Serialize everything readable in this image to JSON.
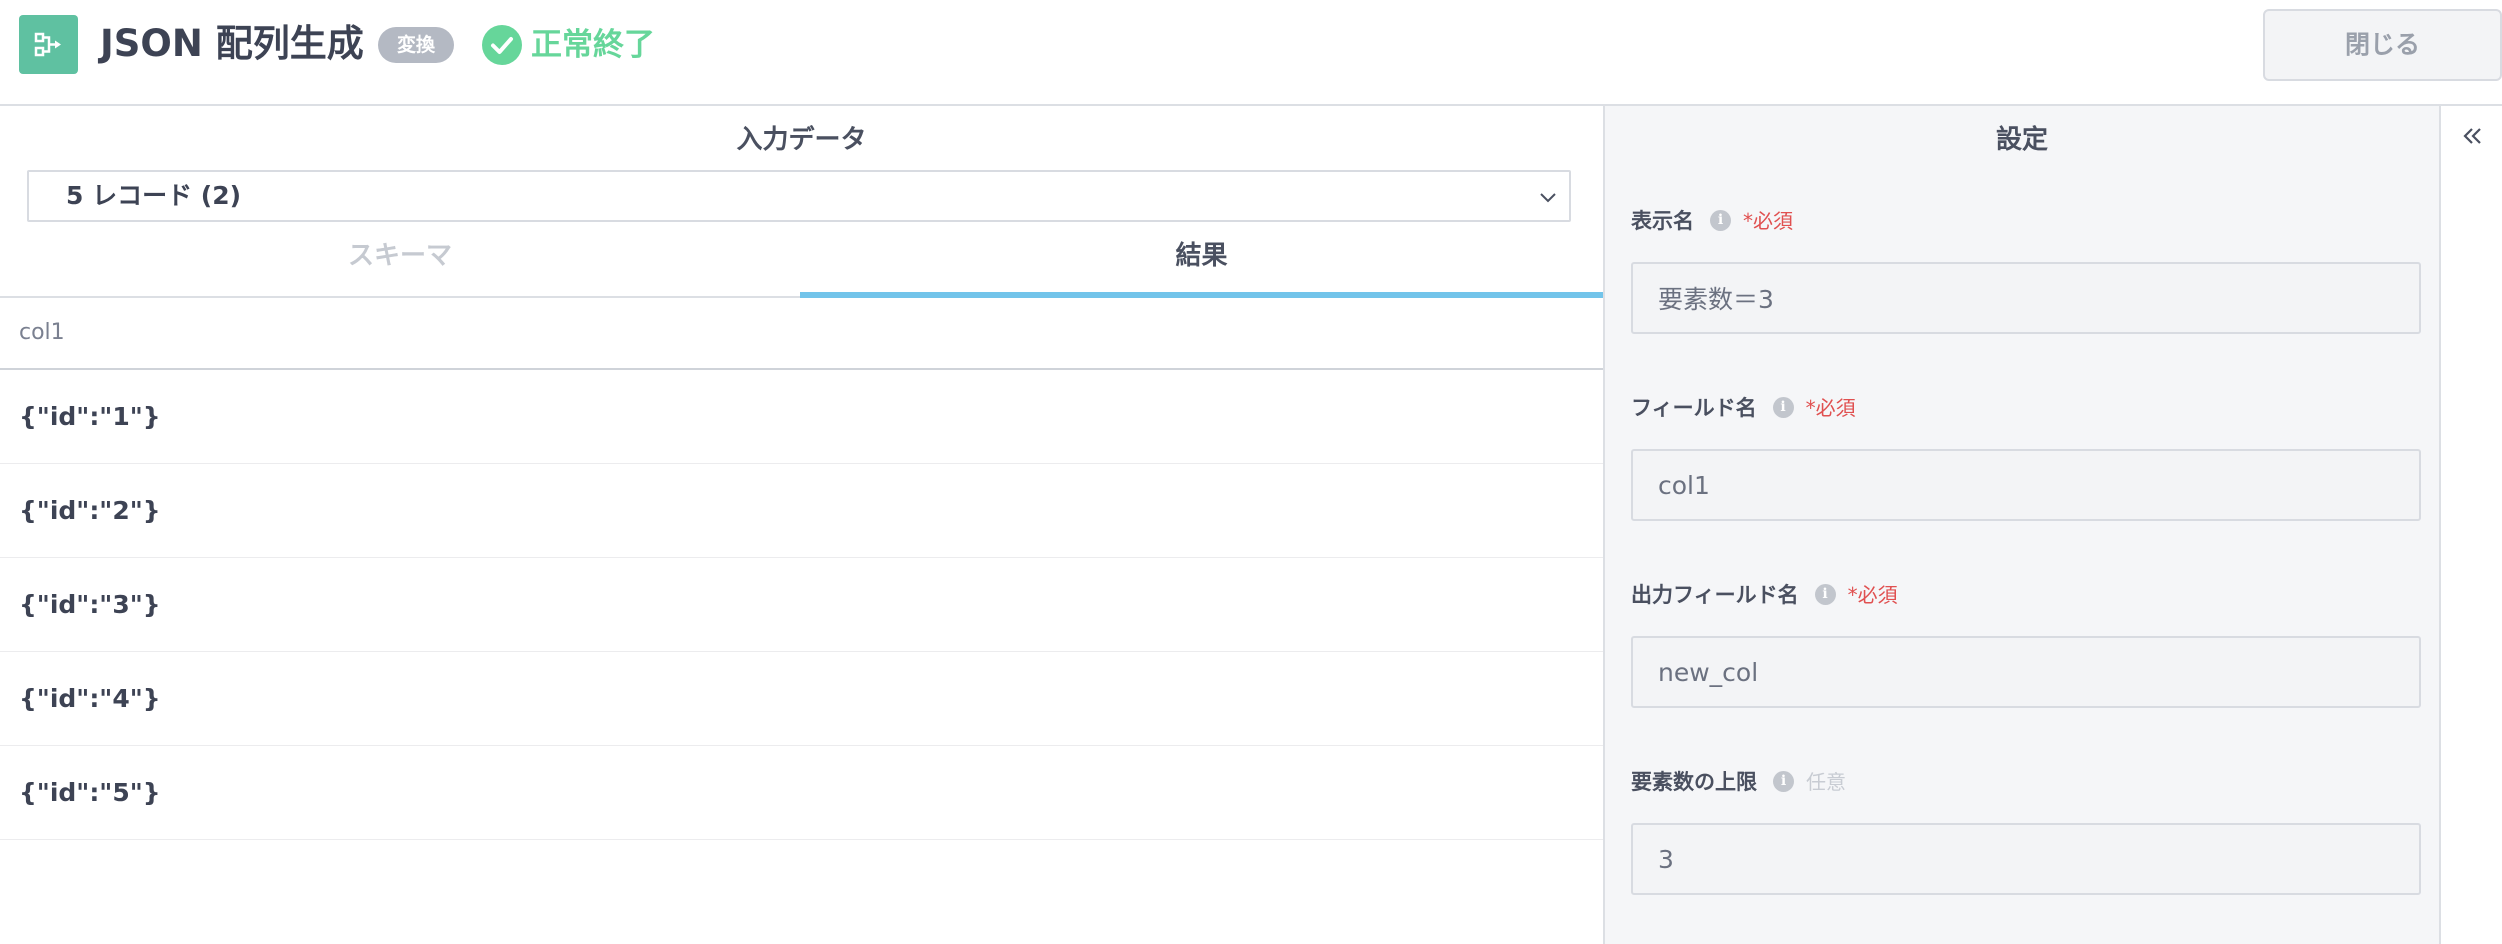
{
  "header": {
    "title": "JSON 配列生成",
    "badge": "変換",
    "status": "正常終了",
    "close_label": "閉じる",
    "icon": "flow-icon"
  },
  "input_panel": {
    "title": "入力データ",
    "record_select": "5 レコード (2)",
    "tabs": [
      {
        "label": "スキーマ",
        "active": false
      },
      {
        "label": "結果",
        "active": true
      }
    ],
    "table": {
      "columns": [
        "col1"
      ],
      "rows": [
        "{\"id\":\"1\"}",
        "{\"id\":\"2\"}",
        "{\"id\":\"3\"}",
        "{\"id\":\"4\"}",
        "{\"id\":\"5\"}"
      ]
    }
  },
  "settings_panel": {
    "title": "設定",
    "fields": [
      {
        "label": "表示名",
        "requirement": "*必須",
        "value": "要素数＝3"
      },
      {
        "label": "フィールド名",
        "requirement": "*必須",
        "value": "col1"
      },
      {
        "label": "出力フィールド名",
        "requirement": "*必須",
        "value": "new_col"
      },
      {
        "label": "要素数の上限",
        "requirement": "任意",
        "value": "3"
      }
    ]
  },
  "colors": {
    "accent": "#5fc1a1",
    "success": "#66d69a",
    "tab_active": "#72c4ea",
    "required": "#e05050"
  }
}
